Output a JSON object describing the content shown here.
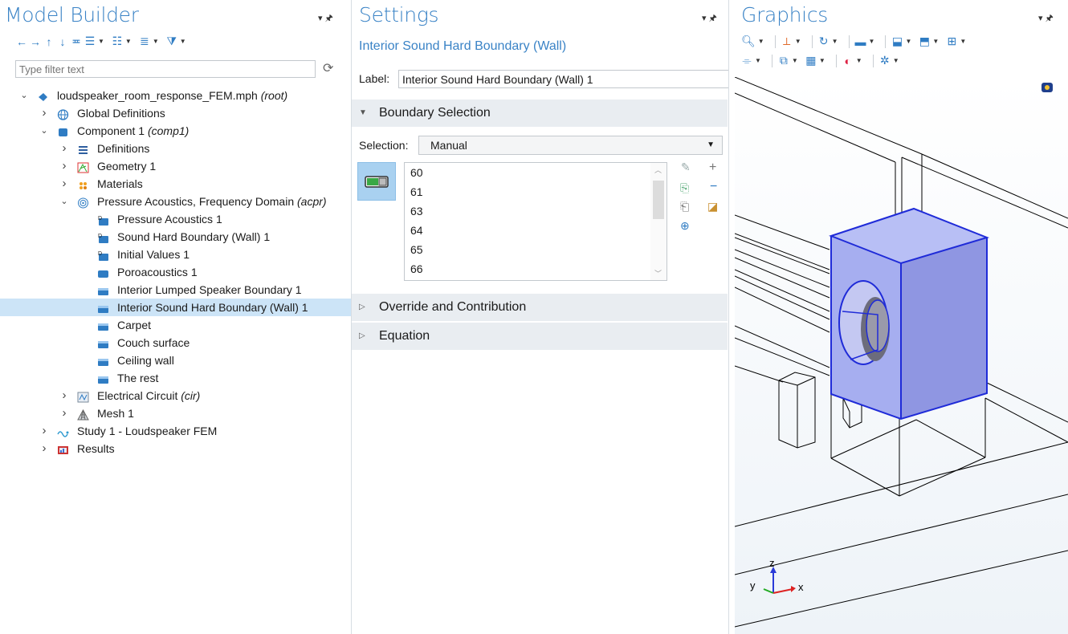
{
  "model_builder": {
    "title": "Model Builder",
    "filter_placeholder": "Type filter text",
    "toolbar_icons": [
      "back-arrow-icon",
      "forward-arrow-icon",
      "move-up-icon",
      "move-down-icon",
      "show-icon",
      "sort-up-icon",
      "sort-down-icon",
      "list-icon",
      "filter-icon"
    ],
    "tree": [
      {
        "label": "loudspeaker_room_response_FEM.mph",
        "suffix": "(root)",
        "chevron": "open",
        "depth": 0,
        "icon": "file-icon"
      },
      {
        "label": "Global Definitions",
        "suffix": "",
        "chevron": "closed",
        "depth": 1,
        "icon": "globe-icon"
      },
      {
        "label": "Component 1",
        "suffix": "(comp1)",
        "chevron": "open",
        "depth": 1,
        "icon": "component-icon"
      },
      {
        "label": "Definitions",
        "suffix": "",
        "chevron": "closed",
        "depth": 2,
        "icon": "definitions-icon"
      },
      {
        "label": "Geometry 1",
        "suffix": "",
        "chevron": "closed",
        "depth": 2,
        "icon": "geometry-icon"
      },
      {
        "label": "Materials",
        "suffix": "",
        "chevron": "closed",
        "depth": 2,
        "icon": "materials-icon"
      },
      {
        "label": "Pressure Acoustics, Frequency Domain",
        "suffix": "(acpr)",
        "chevron": "open",
        "depth": 2,
        "icon": "acoustics-icon"
      },
      {
        "label": "Pressure Acoustics 1",
        "suffix": "",
        "chevron": "none",
        "depth": 3,
        "icon": "domain-feature-icon"
      },
      {
        "label": "Sound Hard Boundary (Wall) 1",
        "suffix": "",
        "chevron": "none",
        "depth": 3,
        "icon": "domain-feature-icon"
      },
      {
        "label": "Initial Values 1",
        "suffix": "",
        "chevron": "none",
        "depth": 3,
        "icon": "domain-feature-icon"
      },
      {
        "label": "Poroacoustics 1",
        "suffix": "",
        "chevron": "none",
        "depth": 3,
        "icon": "domain-node-icon"
      },
      {
        "label": "Interior Lumped Speaker Boundary 1",
        "suffix": "",
        "chevron": "none",
        "depth": 3,
        "icon": "boundary-node-icon"
      },
      {
        "label": "Interior Sound Hard Boundary (Wall) 1",
        "suffix": "",
        "chevron": "none",
        "depth": 3,
        "icon": "boundary-node-icon",
        "selected": true
      },
      {
        "label": "Carpet",
        "suffix": "",
        "chevron": "none",
        "depth": 3,
        "icon": "boundary-node-icon"
      },
      {
        "label": "Couch surface",
        "suffix": "",
        "chevron": "none",
        "depth": 3,
        "icon": "boundary-node-icon"
      },
      {
        "label": "Ceiling wall",
        "suffix": "",
        "chevron": "none",
        "depth": 3,
        "icon": "boundary-node-icon"
      },
      {
        "label": "The rest",
        "suffix": "",
        "chevron": "none",
        "depth": 3,
        "icon": "boundary-node-icon"
      },
      {
        "label": "Electrical Circuit",
        "suffix": "(cir)",
        "chevron": "closed",
        "depth": 2,
        "icon": "circuit-icon"
      },
      {
        "label": "Mesh 1",
        "suffix": "",
        "chevron": "closed",
        "depth": 2,
        "icon": "mesh-icon"
      },
      {
        "label": "Study 1 - Loudspeaker FEM",
        "suffix": "",
        "chevron": "closed",
        "depth": 1,
        "icon": "study-icon"
      },
      {
        "label": "Results",
        "suffix": "",
        "chevron": "closed",
        "depth": 1,
        "icon": "results-icon"
      }
    ]
  },
  "settings": {
    "title": "Settings",
    "subtitle": "Interior Sound Hard Boundary (Wall)",
    "label_caption": "Label:",
    "label_value": "Interior Sound Hard Boundary (Wall) 1",
    "sections": {
      "boundary_selection": "Boundary Selection",
      "override": "Override and Contribution",
      "equation": "Equation"
    },
    "selection_caption": "Selection:",
    "selection_value": "Manual",
    "boundaries": [
      "60",
      "61",
      "63",
      "64",
      "65",
      "66"
    ]
  },
  "graphics": {
    "title": "Graphics",
    "axes": {
      "z": "z",
      "y": "y",
      "x": "x"
    },
    "colors": {
      "speaker_face_front": "#a6aef0",
      "speaker_face_side": "#8f96e2",
      "speaker_face_top": "#b8bff5",
      "edge_highlight": "#1f2bd8"
    }
  },
  "colors": {
    "accent": "#3a83c6",
    "selected_row": "#cce4f7",
    "section_bg": "#e9edf1"
  }
}
